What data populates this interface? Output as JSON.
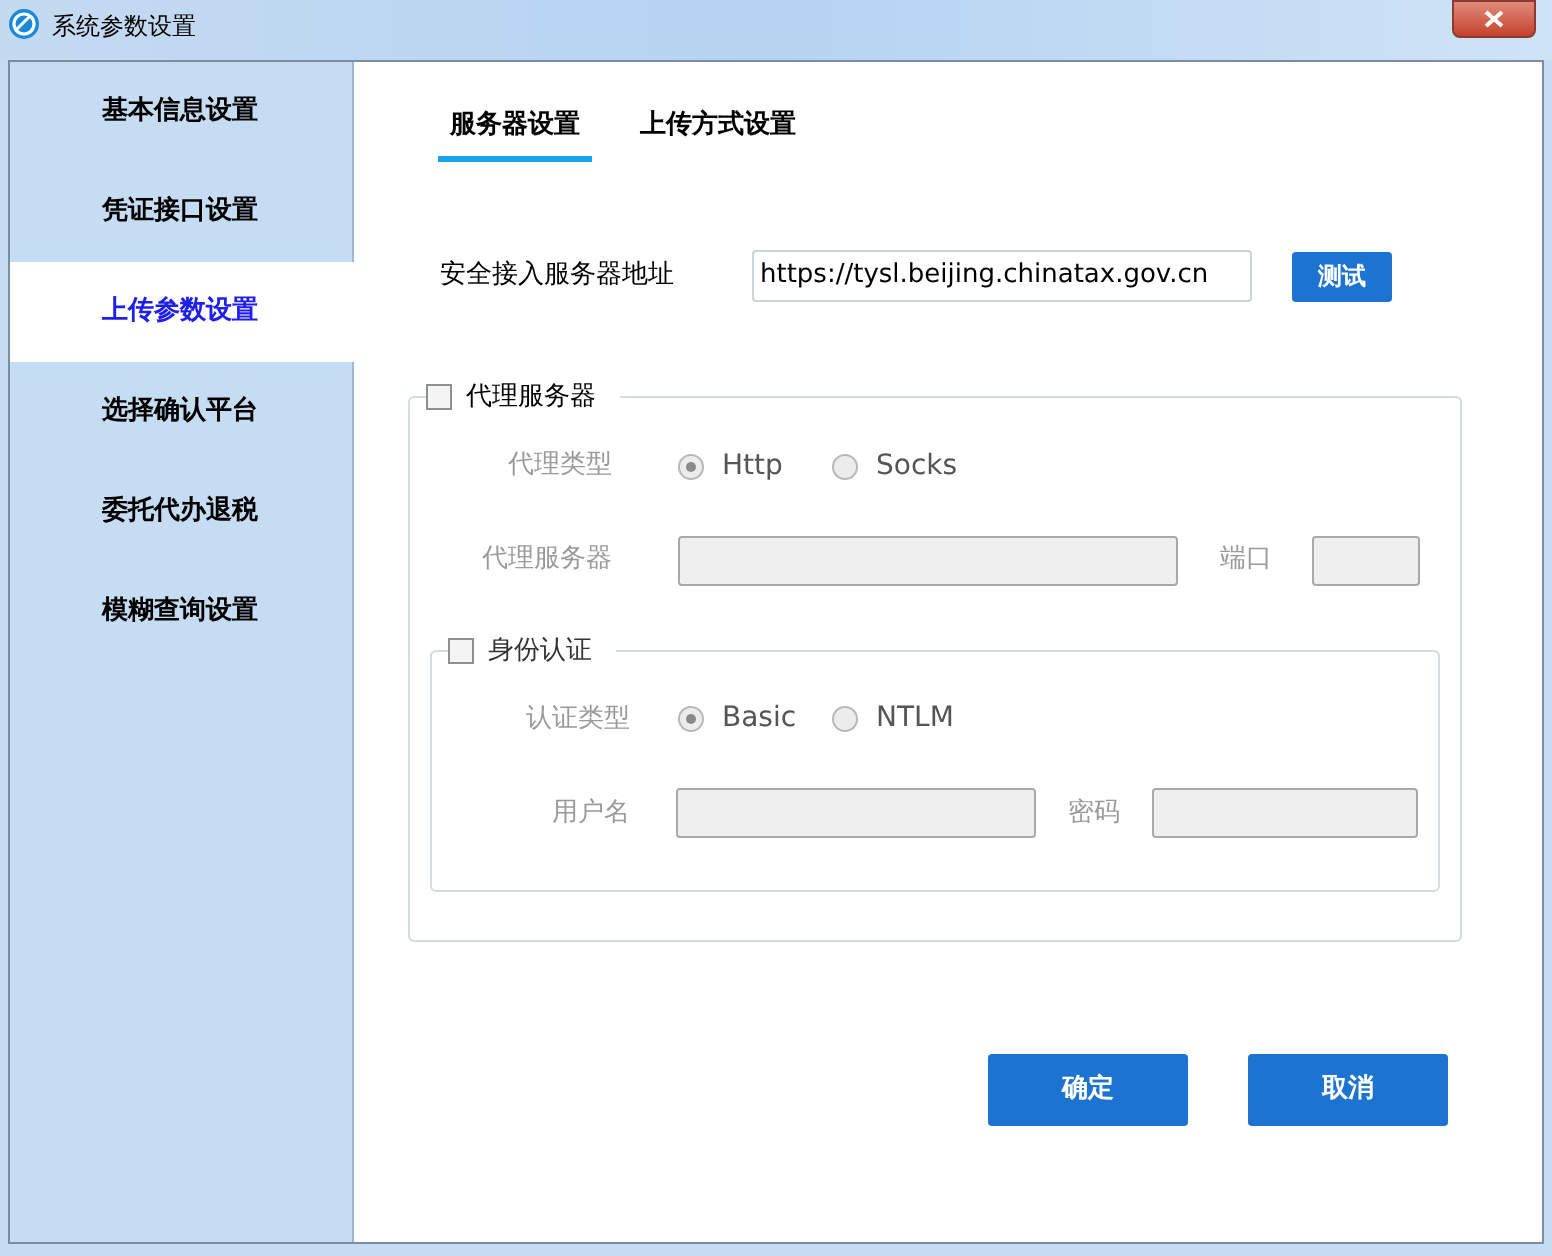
{
  "window": {
    "title": "系统参数设置"
  },
  "sidebar": {
    "items": [
      {
        "label": "基本信息设置",
        "selected": false
      },
      {
        "label": "凭证接口设置",
        "selected": false
      },
      {
        "label": "上传参数设置",
        "selected": true
      },
      {
        "label": "选择确认平台",
        "selected": false
      },
      {
        "label": "委托代办退税",
        "selected": false
      },
      {
        "label": "模糊查询设置",
        "selected": false
      }
    ]
  },
  "tabs": [
    {
      "label": "服务器设置",
      "selected": true
    },
    {
      "label": "上传方式设置",
      "selected": false
    }
  ],
  "server": {
    "label": "安全接入服务器地址",
    "value": "https://tysl.beijing.chinatax.gov.cn",
    "button": "测试"
  },
  "proxy": {
    "label": "代理服务器",
    "checked": false,
    "disabled": true,
    "type_label": "代理类型",
    "options": [
      {
        "label": "Http",
        "selected": true
      },
      {
        "label": "Socks",
        "selected": false
      }
    ],
    "server_label": "代理服务器",
    "port_label": "端口",
    "auth": {
      "label": "身份认证",
      "checked": false,
      "disabled": true,
      "type_label": "认证类型",
      "options": [
        {
          "label": "Basic",
          "selected": true
        },
        {
          "label": "NTLM",
          "selected": false
        }
      ],
      "user_label": "用户名",
      "password_label": "密码"
    }
  },
  "buttons": [
    "确定",
    "取消"
  ]
}
